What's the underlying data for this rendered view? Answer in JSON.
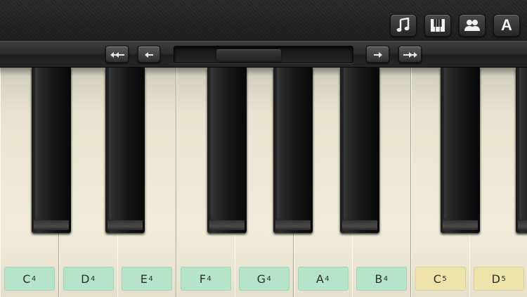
{
  "toolbar": {
    "buttons": [
      {
        "name": "music-note-icon"
      },
      {
        "name": "piano-keys-icon"
      },
      {
        "name": "users-icon"
      },
      {
        "name": "font-letter-icon",
        "label": "A"
      }
    ]
  },
  "navigation": {
    "buttons": [
      {
        "name": "double-arrow-left-icon"
      },
      {
        "name": "arrow-left-icon"
      },
      {
        "name": "arrow-right-icon"
      },
      {
        "name": "double-arrow-right-icon"
      }
    ],
    "scroll_position": 0.34
  },
  "keyboard": {
    "white_keys": [
      {
        "note": "C",
        "octave": "4",
        "color": "#b6e4cb"
      },
      {
        "note": "D",
        "octave": "4",
        "color": "#b6e4cb"
      },
      {
        "note": "E",
        "octave": "4",
        "color": "#b6e4cb"
      },
      {
        "note": "F",
        "octave": "4",
        "color": "#b6e4cb"
      },
      {
        "note": "G",
        "octave": "4",
        "color": "#b6e4cb"
      },
      {
        "note": "A",
        "octave": "4",
        "color": "#b6e4cb"
      },
      {
        "note": "B",
        "octave": "4",
        "color": "#b6e4cb"
      },
      {
        "note": "C",
        "octave": "5",
        "color": "#ede3ab"
      },
      {
        "note": "D",
        "octave": "5",
        "color": "#ede3ab"
      }
    ]
  }
}
